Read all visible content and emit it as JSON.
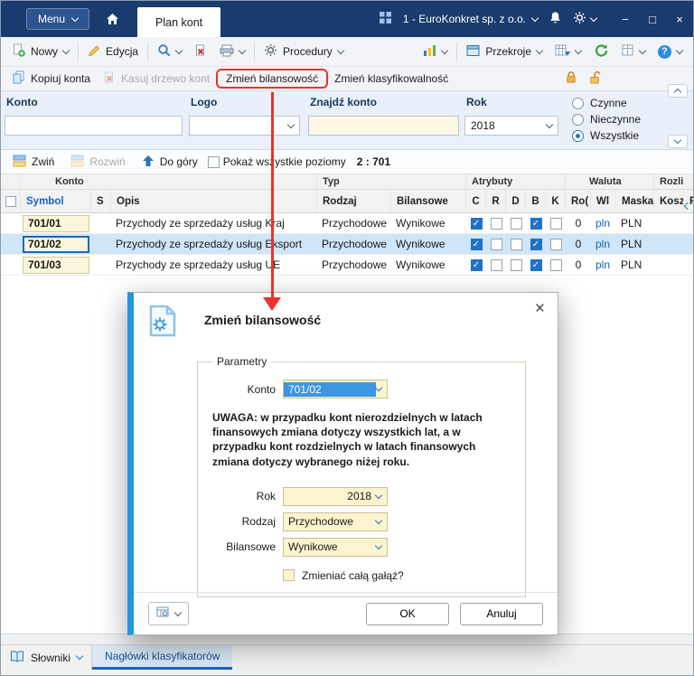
{
  "titlebar": {
    "menu": "Menu",
    "tab": "Plan kont",
    "company": "1 - EuroKonkret sp. z o.o.",
    "minimize": "−",
    "maximize": "□",
    "close": "×"
  },
  "toolbar": {
    "nowy": "Nowy",
    "edycja": "Edycja",
    "procedury": "Procedury",
    "przekroje": "Przekroje",
    "help": "?"
  },
  "actions": {
    "kopiuj": "Kopiuj konta",
    "kasuj": "Kasuj drzewo kont",
    "zmien_bilansowosc": "Zmień bilansowość",
    "zmien_klasyfikowalnosc": "Zmień klasyfikowalność"
  },
  "filters": {
    "konto_label": "Konto",
    "konto_value": "",
    "logo_label": "Logo",
    "logo_value": "",
    "znajdz_label": "Znajdź konto",
    "znajdz_value": "",
    "rok_label": "Rok",
    "rok_value": "2018",
    "radios": [
      {
        "label": "Czynne",
        "on": false
      },
      {
        "label": "Nieczynne",
        "on": false
      },
      {
        "label": "Wszystkie",
        "on": true
      }
    ]
  },
  "treebar": {
    "zwin": "Zwiń",
    "rozwin": "Rozwiń",
    "do_gory": "Do góry",
    "pokaz": "Pokaż wszystkie poziomy",
    "pokaz_on": false,
    "level": "2 : 701"
  },
  "table": {
    "groups": {
      "konto": "Konto",
      "typ": "Typ",
      "atrybuty": "Atrybuty",
      "waluta": "Waluta",
      "rozliczenia": "Rozli"
    },
    "headers": {
      "symbol": "Symbol",
      "s": "S",
      "opis": "Opis",
      "rodzaj": "Rodzaj",
      "bilansowe": "Bilansowe",
      "c": "C",
      "r": "R",
      "d": "D",
      "b": "B",
      "k": "K",
      "rok": "Ro(",
      "wl": "Wl",
      "maska": "Maska",
      "koszty": "Kosz",
      "p": "P"
    },
    "rows": [
      {
        "symbol": "701/01",
        "s": "",
        "opis": "Przychody ze sprzedaży usług Kraj",
        "rodzaj": "Przychodowe",
        "bilansowe": "Wynikowe",
        "c": true,
        "r": false,
        "d": false,
        "b": true,
        "k": false,
        "rok": "0",
        "wl": "pln",
        "maska": "PLN",
        "selected": false,
        "focused": false
      },
      {
        "symbol": "701/02",
        "s": "",
        "opis": "Przychody ze sprzedaży usług Eksport",
        "rodzaj": "Przychodowe",
        "bilansowe": "Wynikowe",
        "c": true,
        "r": false,
        "d": false,
        "b": true,
        "k": false,
        "rok": "0",
        "wl": "pln",
        "maska": "PLN",
        "selected": true,
        "focused": true
      },
      {
        "symbol": "701/03",
        "s": "",
        "opis": "Przychody ze sprzedaży usług UE",
        "rodzaj": "Przychodowe",
        "bilansowe": "Wynikowe",
        "c": true,
        "r": false,
        "d": false,
        "b": true,
        "k": false,
        "rok": "0",
        "wl": "pln",
        "maska": "PLN",
        "selected": false,
        "focused": false
      }
    ]
  },
  "dialog": {
    "title": "Zmień bilansowość",
    "close": "×",
    "group": "Parametry",
    "konto_label": "Konto",
    "konto_value": "701/02",
    "warning": "UWAGA:  w przypadku kont nierozdzielnych w latach finansowych zmiana dotyczy wszystkich lat, a w przypadku kont rozdzielnych w latach finansowych zmiana dotyczy wybranego niżej roku.",
    "rok_label": "Rok",
    "rok_value": "2018",
    "rodzaj_label": "Rodzaj",
    "rodzaj_value": "Przychodowe",
    "bilansowe_label": "Bilansowe",
    "bilansowe_value": "Wynikowe",
    "branch_label": "Zmieniać całą gałąź?",
    "branch_on": false,
    "ok": "OK",
    "anuluj": "Anuluj"
  },
  "statusbar": {
    "slowniki": "Słowniki",
    "tab": "Nagłówki klasyfikatorów"
  },
  "colors": {
    "titlebar": "#1a3b6d",
    "accent": "#1565c0",
    "dialog_stripe": "#2196e0",
    "annotation_red": "#e8332a",
    "row_selected": "#cfe5f8",
    "field_yellow": "#fcf4cf"
  },
  "icons": {
    "home-icon": "house",
    "apps-grid-icon": "grid-tiles",
    "bell-icon": "bell",
    "gear-icon": "gear",
    "new-page-icon": "page-green-plus",
    "pencil-icon": "pencil",
    "search-icon": "magnifier",
    "delete-icon": "page-red-x",
    "printer-icon": "printer",
    "bar-chart-icon": "colored-bars",
    "window-panels-icon": "panel",
    "grid-arrow-icon": "grid-blue-arrow",
    "refresh-icon": "green-circular-arrow",
    "layout-grid-icon": "grid",
    "help-icon": "?",
    "copy-icon": "two-pages",
    "lock-closed-icon": "orange-padlock-closed",
    "lock-open-icon": "orange-padlock-open",
    "collapse-icon": "stacked-panels",
    "expand-icon": "stacked-panels",
    "up-arrow-icon": "blue-arrow-up",
    "book-icon": "open-book",
    "document-gear-icon": "doc-with-gear",
    "chevron-down-icon": "v",
    "chevron-up-icon": "^",
    "chevron-left-icon": "<",
    "checkmark": "✓"
  }
}
